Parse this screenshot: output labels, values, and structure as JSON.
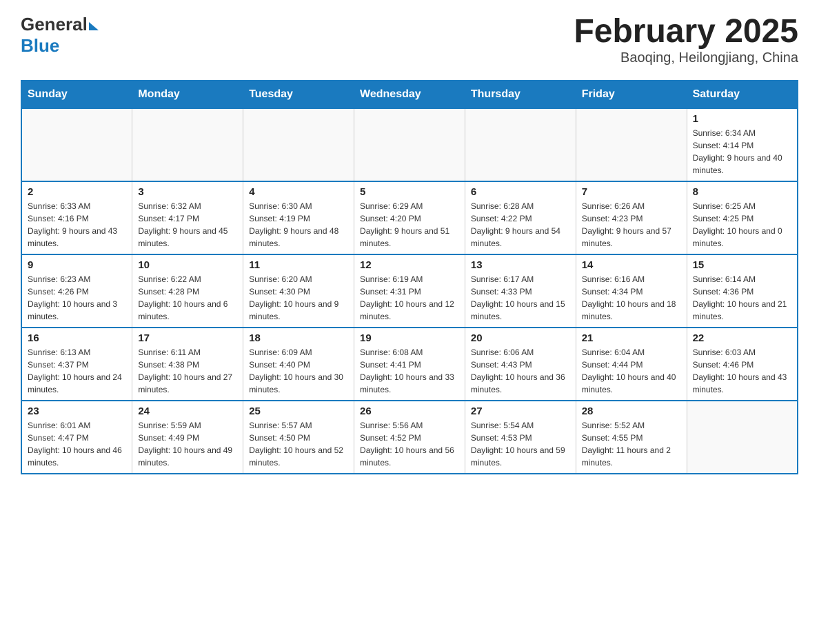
{
  "header": {
    "logo_general": "General",
    "logo_blue": "Blue",
    "month_title": "February 2025",
    "location": "Baoqing, Heilongjiang, China"
  },
  "calendar": {
    "days_of_week": [
      "Sunday",
      "Monday",
      "Tuesday",
      "Wednesday",
      "Thursday",
      "Friday",
      "Saturday"
    ],
    "weeks": [
      [
        {
          "day": "",
          "info": ""
        },
        {
          "day": "",
          "info": ""
        },
        {
          "day": "",
          "info": ""
        },
        {
          "day": "",
          "info": ""
        },
        {
          "day": "",
          "info": ""
        },
        {
          "day": "",
          "info": ""
        },
        {
          "day": "1",
          "info": "Sunrise: 6:34 AM\nSunset: 4:14 PM\nDaylight: 9 hours and 40 minutes."
        }
      ],
      [
        {
          "day": "2",
          "info": "Sunrise: 6:33 AM\nSunset: 4:16 PM\nDaylight: 9 hours and 43 minutes."
        },
        {
          "day": "3",
          "info": "Sunrise: 6:32 AM\nSunset: 4:17 PM\nDaylight: 9 hours and 45 minutes."
        },
        {
          "day": "4",
          "info": "Sunrise: 6:30 AM\nSunset: 4:19 PM\nDaylight: 9 hours and 48 minutes."
        },
        {
          "day": "5",
          "info": "Sunrise: 6:29 AM\nSunset: 4:20 PM\nDaylight: 9 hours and 51 minutes."
        },
        {
          "day": "6",
          "info": "Sunrise: 6:28 AM\nSunset: 4:22 PM\nDaylight: 9 hours and 54 minutes."
        },
        {
          "day": "7",
          "info": "Sunrise: 6:26 AM\nSunset: 4:23 PM\nDaylight: 9 hours and 57 minutes."
        },
        {
          "day": "8",
          "info": "Sunrise: 6:25 AM\nSunset: 4:25 PM\nDaylight: 10 hours and 0 minutes."
        }
      ],
      [
        {
          "day": "9",
          "info": "Sunrise: 6:23 AM\nSunset: 4:26 PM\nDaylight: 10 hours and 3 minutes."
        },
        {
          "day": "10",
          "info": "Sunrise: 6:22 AM\nSunset: 4:28 PM\nDaylight: 10 hours and 6 minutes."
        },
        {
          "day": "11",
          "info": "Sunrise: 6:20 AM\nSunset: 4:30 PM\nDaylight: 10 hours and 9 minutes."
        },
        {
          "day": "12",
          "info": "Sunrise: 6:19 AM\nSunset: 4:31 PM\nDaylight: 10 hours and 12 minutes."
        },
        {
          "day": "13",
          "info": "Sunrise: 6:17 AM\nSunset: 4:33 PM\nDaylight: 10 hours and 15 minutes."
        },
        {
          "day": "14",
          "info": "Sunrise: 6:16 AM\nSunset: 4:34 PM\nDaylight: 10 hours and 18 minutes."
        },
        {
          "day": "15",
          "info": "Sunrise: 6:14 AM\nSunset: 4:36 PM\nDaylight: 10 hours and 21 minutes."
        }
      ],
      [
        {
          "day": "16",
          "info": "Sunrise: 6:13 AM\nSunset: 4:37 PM\nDaylight: 10 hours and 24 minutes."
        },
        {
          "day": "17",
          "info": "Sunrise: 6:11 AM\nSunset: 4:38 PM\nDaylight: 10 hours and 27 minutes."
        },
        {
          "day": "18",
          "info": "Sunrise: 6:09 AM\nSunset: 4:40 PM\nDaylight: 10 hours and 30 minutes."
        },
        {
          "day": "19",
          "info": "Sunrise: 6:08 AM\nSunset: 4:41 PM\nDaylight: 10 hours and 33 minutes."
        },
        {
          "day": "20",
          "info": "Sunrise: 6:06 AM\nSunset: 4:43 PM\nDaylight: 10 hours and 36 minutes."
        },
        {
          "day": "21",
          "info": "Sunrise: 6:04 AM\nSunset: 4:44 PM\nDaylight: 10 hours and 40 minutes."
        },
        {
          "day": "22",
          "info": "Sunrise: 6:03 AM\nSunset: 4:46 PM\nDaylight: 10 hours and 43 minutes."
        }
      ],
      [
        {
          "day": "23",
          "info": "Sunrise: 6:01 AM\nSunset: 4:47 PM\nDaylight: 10 hours and 46 minutes."
        },
        {
          "day": "24",
          "info": "Sunrise: 5:59 AM\nSunset: 4:49 PM\nDaylight: 10 hours and 49 minutes."
        },
        {
          "day": "25",
          "info": "Sunrise: 5:57 AM\nSunset: 4:50 PM\nDaylight: 10 hours and 52 minutes."
        },
        {
          "day": "26",
          "info": "Sunrise: 5:56 AM\nSunset: 4:52 PM\nDaylight: 10 hours and 56 minutes."
        },
        {
          "day": "27",
          "info": "Sunrise: 5:54 AM\nSunset: 4:53 PM\nDaylight: 10 hours and 59 minutes."
        },
        {
          "day": "28",
          "info": "Sunrise: 5:52 AM\nSunset: 4:55 PM\nDaylight: 11 hours and 2 minutes."
        },
        {
          "day": "",
          "info": ""
        }
      ]
    ]
  }
}
